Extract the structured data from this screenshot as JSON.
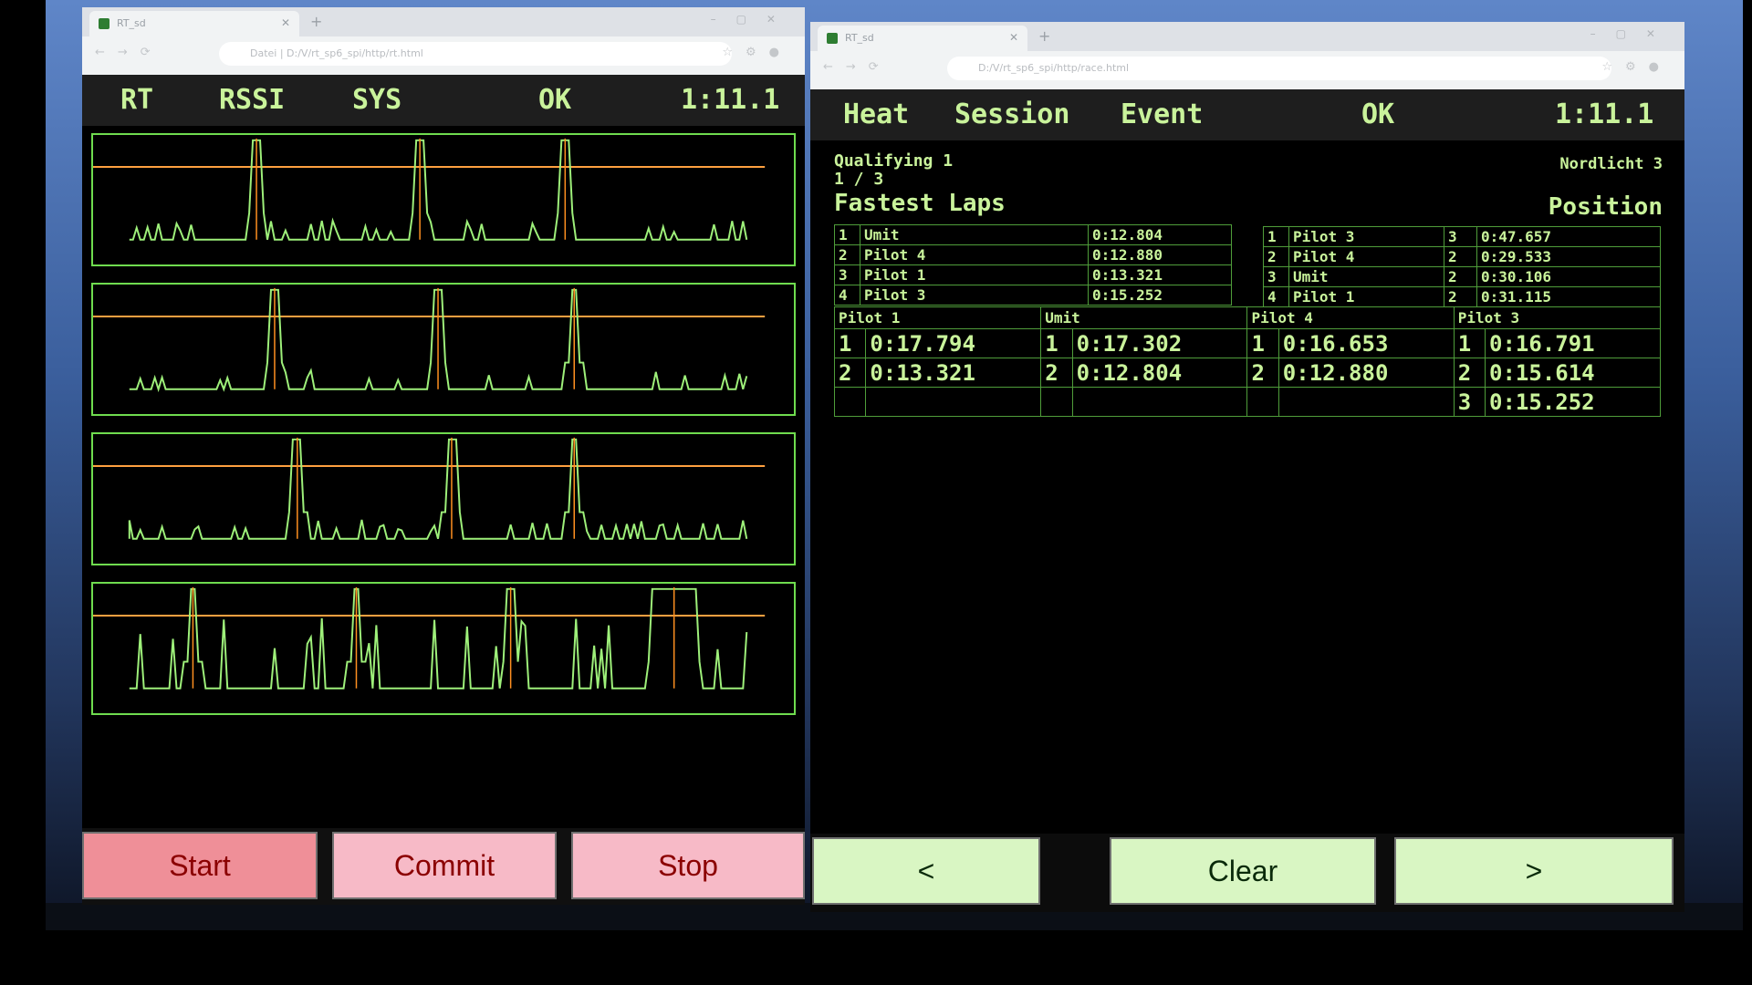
{
  "left_window": {
    "tab_title": "RT_sd",
    "address": "Datei | D:/V/rt_sp6_spi/http/rt.html",
    "header": {
      "rt": "RT",
      "rssi": "RSSI",
      "sys": "SYS",
      "ok": "OK",
      "time": "1:11.1"
    },
    "buttons": {
      "start": "Start",
      "commit": "Commit",
      "stop": "Stop"
    },
    "colors": {
      "trace": "#9ef07a",
      "threshold": "#ffa040",
      "marker": "#ff9020",
      "frame": "#6fdc4f"
    }
  },
  "right_window": {
    "tab_title": "RT_sd",
    "address": "D:/V/rt_sp6_spi/http/race.html",
    "header": {
      "heat": "Heat",
      "session": "Session",
      "event": "Event",
      "ok": "OK",
      "time": "1:11.1"
    },
    "session_name": "Qualifying 1",
    "heat_progress": "1 / 3",
    "location": "Nordlicht 3",
    "fastest_title": "Fastest Laps",
    "position_title": "Position",
    "fastest_laps": [
      {
        "rank": "1",
        "pilot": "Umit",
        "time": "0:12.804"
      },
      {
        "rank": "2",
        "pilot": "Pilot 4",
        "time": "0:12.880"
      },
      {
        "rank": "3",
        "pilot": "Pilot 1",
        "time": "0:13.321"
      },
      {
        "rank": "4",
        "pilot": "Pilot 3",
        "time": "0:15.252"
      }
    ],
    "positions": [
      {
        "rank": "1",
        "pilot": "Pilot 3",
        "laps": "3",
        "time": "0:47.657"
      },
      {
        "rank": "2",
        "pilot": "Pilot 4",
        "laps": "2",
        "time": "0:29.533"
      },
      {
        "rank": "3",
        "pilot": "Umit",
        "laps": "2",
        "time": "0:30.106"
      },
      {
        "rank": "4",
        "pilot": "Pilot 1",
        "laps": "2",
        "time": "0:31.115"
      }
    ],
    "lap_columns": [
      "Pilot 1",
      "Umit",
      "Pilot 4",
      "Pilot 3"
    ],
    "lap_rows": [
      [
        [
          "1",
          "0:17.794"
        ],
        [
          "1",
          "0:17.302"
        ],
        [
          "1",
          "0:16.653"
        ],
        [
          "1",
          "0:16.791"
        ]
      ],
      [
        [
          "2",
          "0:13.321"
        ],
        [
          "2",
          "0:12.804"
        ],
        [
          "2",
          "0:12.880"
        ],
        [
          "2",
          "0:15.614"
        ]
      ],
      [
        [
          "",
          ""
        ],
        [
          "",
          ""
        ],
        [
          "",
          ""
        ],
        [
          "3",
          "0:15.252"
        ]
      ]
    ],
    "buttons": {
      "prev": "<",
      "clear": "Clear",
      "next": ">"
    }
  }
}
